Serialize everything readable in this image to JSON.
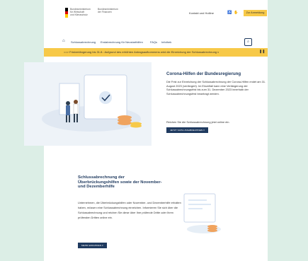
{
  "colors": {
    "navy": "#1f3a5f",
    "yellow": "#f7c948",
    "background": "#dceee6"
  },
  "header": {
    "ministry_left": [
      "Bundesministerium",
      "für Wirtschaft",
      "und Klimaschutz"
    ],
    "ministry_right": [
      "Bundesministerium",
      "der Finanzen"
    ],
    "contact": "Kontakt und Hotline",
    "accessibility_icon": "accessibility-icon",
    "sign_language_icon": "sign-language-icon",
    "login": "Zur Anmeldung"
  },
  "nav": {
    "home_icon": "home-icon",
    "items": [
      "Schlussabrechnung",
      "Endabrechnung für Neustarthilfen",
      "FAQs",
      "Infothek"
    ],
    "search_icon": "search-icon"
  },
  "banner": {
    "text": "==> Fristverlängerung bis 31.8.: Aufgrund des erhöhten Antragsaufkommens wird die Einreichung der Schlussabrechnung v",
    "icon": "close-icon"
  },
  "hero": {
    "title": "Corona-Hilfen der Bundesregierung",
    "text": "Die Frist zur Einreichung der Schlussabrechnung der Corona-Hilfen endet am 31. August 2023 (verlängert). Im Einzelfall kann eine Verlängerung der Schlussabrechnungsfrist bis zum 31. Dezember 2023 innerhalb der Schlussabrechnungsfrist beantragt werden.",
    "cta_text": "Reichen Sie die Schlussabrechnung jetzt online ein.",
    "button": "JETZT SCHLUSSABRECHNEN"
  },
  "card": {
    "title": "Schlussabrechnung der Überbrückungshilfen sowie der November- und Dezemberhilfe",
    "text": "Unternehmen, die Überbrückungshilfen oder November- und Dezemberhilfe erhalten haben, müssen eine Schlussabrechnung einreichen. Informieren Sie sich über die Schlussabrechnung und reichen Sie diese über Ihre prüfende Dritte oder Ihren prüfenden Dritten online ein.",
    "button": "MEHR ERFAHREN"
  }
}
